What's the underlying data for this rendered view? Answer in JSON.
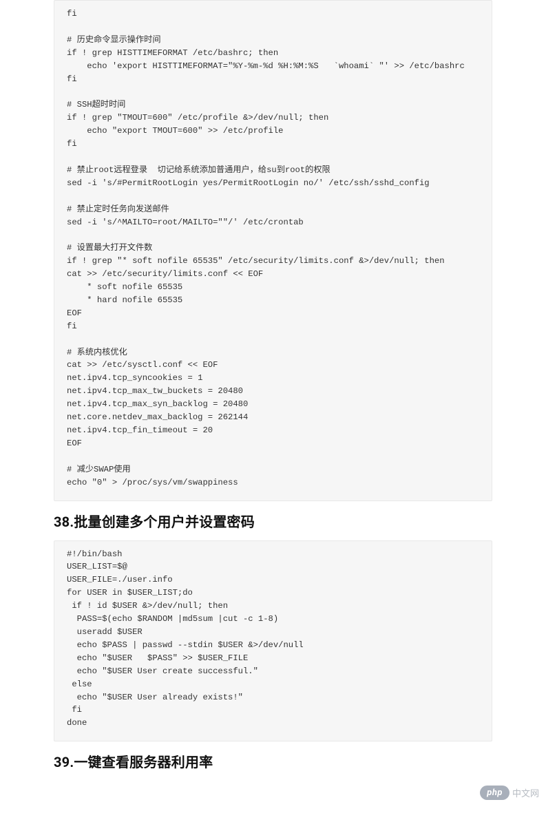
{
  "code_block_1": "fi\n\n# 历史命令显示操作时间\nif ! grep HISTTIMEFORMAT /etc/bashrc; then\n    echo 'export HISTTIMEFORMAT=\"%Y-%m-%d %H:%M:%S   `whoami` \"' >> /etc/bashrc\nfi\n\n# SSH超时时间\nif ! grep \"TMOUT=600\" /etc/profile &>/dev/null; then\n    echo \"export TMOUT=600\" >> /etc/profile\nfi\n\n# 禁止root远程登录  切记给系统添加普通用户，给su到root的权限\nsed -i 's/#PermitRootLogin yes/PermitRootLogin no/' /etc/ssh/sshd_config\n\n# 禁止定时任务向发送邮件\nsed -i 's/^MAILTO=root/MAILTO=\"\"/' /etc/crontab\n\n# 设置最大打开文件数\nif ! grep \"* soft nofile 65535\" /etc/security/limits.conf &>/dev/null; then\ncat >> /etc/security/limits.conf << EOF\n    * soft nofile 65535\n    * hard nofile 65535\nEOF\nfi\n\n# 系统内核优化\ncat >> /etc/sysctl.conf << EOF\nnet.ipv4.tcp_syncookies = 1\nnet.ipv4.tcp_max_tw_buckets = 20480\nnet.ipv4.tcp_max_syn_backlog = 20480\nnet.core.netdev_max_backlog = 262144\nnet.ipv4.tcp_fin_timeout = 20\nEOF\n\n# 减少SWAP使用\necho \"0\" > /proc/sys/vm/swappiness",
  "heading_38": "38.批量创建多个用户并设置密码",
  "code_block_2": "#!/bin/bash\nUSER_LIST=$@\nUSER_FILE=./user.info\nfor USER in $USER_LIST;do\n if ! id $USER &>/dev/null; then\n  PASS=$(echo $RANDOM |md5sum |cut -c 1-8)\n  useradd $USER\n  echo $PASS | passwd --stdin $USER &>/dev/null\n  echo \"$USER   $PASS\" >> $USER_FILE\n  echo \"$USER User create successful.\"\n else\n  echo \"$USER User already exists!\"\n fi\ndone",
  "heading_39": "39.一键查看服务器利用率",
  "watermark": {
    "badge": "php",
    "text": "中文网"
  }
}
